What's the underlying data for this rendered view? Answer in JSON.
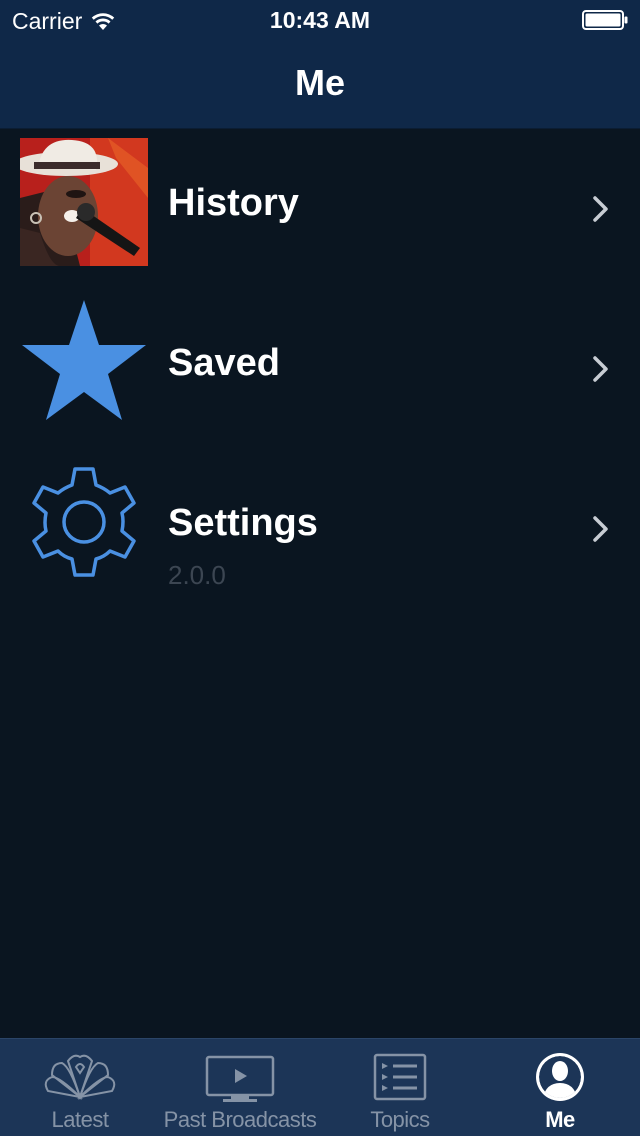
{
  "status_bar": {
    "carrier": "Carrier",
    "time": "10:43 AM"
  },
  "nav": {
    "title": "Me"
  },
  "menu": {
    "items": [
      {
        "label": "History",
        "icon": "history-photo-icon"
      },
      {
        "label": "Saved",
        "icon": "star-icon"
      },
      {
        "label": "Settings",
        "icon": "gear-icon",
        "subtitle": "2.0.0"
      }
    ]
  },
  "tab_bar": {
    "tabs": [
      {
        "label": "Latest",
        "icon": "peacock-icon",
        "active": false
      },
      {
        "label": "Past Broadcasts",
        "icon": "tv-play-icon",
        "active": false
      },
      {
        "label": "Topics",
        "icon": "list-icon",
        "active": false
      },
      {
        "label": "Me",
        "icon": "person-icon",
        "active": true
      }
    ]
  },
  "colors": {
    "nav_background": "#0f2848",
    "content_background": "#0a1520",
    "tab_bar_background": "#1c3557",
    "accent_blue": "#4a90e2",
    "inactive_tab": "#8593a6",
    "version_text": "#3c4652"
  }
}
